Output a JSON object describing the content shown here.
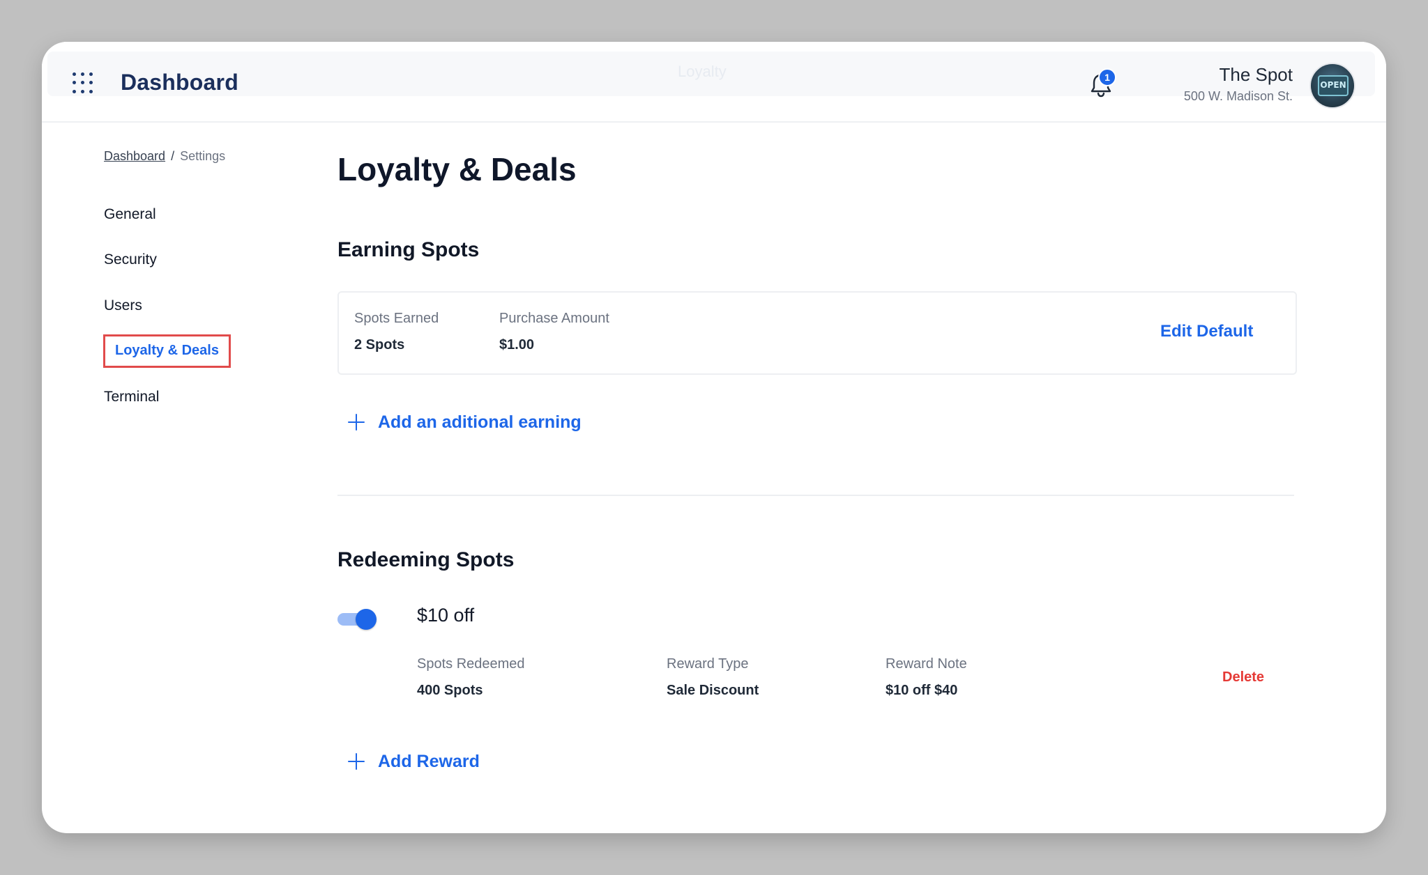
{
  "header": {
    "title": "Dashboard",
    "center_label": "Loyalty",
    "notifications_count": "1",
    "store_name": "The Spot",
    "store_address": "500 W. Madison St.",
    "avatar_sign": "OPEN"
  },
  "breadcrumb": {
    "root": "Dashboard",
    "separator": "/",
    "current": "Settings"
  },
  "sidebar": {
    "items": [
      {
        "label": "General"
      },
      {
        "label": "Security"
      },
      {
        "label": "Users"
      },
      {
        "label": "Loyalty & Deals"
      },
      {
        "label": "Terminal"
      }
    ],
    "active_index": 3
  },
  "main": {
    "title": "Loyalty & Deals",
    "earning": {
      "title": "Earning Spots",
      "spots_earned_label": "Spots Earned",
      "spots_earned_value": "2 Spots",
      "purchase_amount_label": "Purchase Amount",
      "purchase_amount_value": "$1.00",
      "edit_label": "Edit Default",
      "add_label": "Add an aditional earning"
    },
    "redeeming": {
      "title": "Redeeming Spots",
      "reward": {
        "enabled": true,
        "name": "$10 off",
        "spots_redeemed_label": "Spots Redeemed",
        "spots_redeemed_value": "400 Spots",
        "reward_type_label": "Reward Type",
        "reward_type_value": "Sale Discount",
        "reward_note_label": "Reward Note",
        "reward_note_value": "$10 off $40",
        "delete_label": "Delete"
      },
      "add_label": "Add Reward"
    }
  },
  "colors": {
    "accent": "#1d66e8",
    "danger": "#e53935",
    "highlight_box": "#e14b4b",
    "title_navy": "#1b2f5c"
  }
}
